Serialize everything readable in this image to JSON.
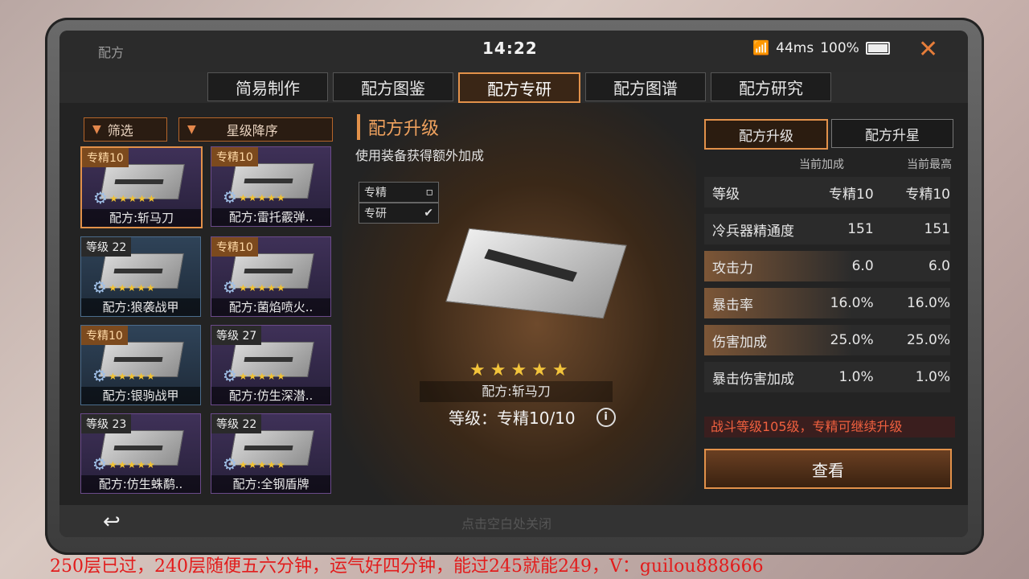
{
  "window": {
    "title": "配方",
    "time": "14:22",
    "ping": "44ms",
    "battery": "100%"
  },
  "tabs": [
    {
      "label": "简易制作"
    },
    {
      "label": "配方图鉴"
    },
    {
      "label": "配方专研",
      "active": true
    },
    {
      "label": "配方图谱"
    },
    {
      "label": "配方研究"
    }
  ],
  "filters": {
    "filter_label": "筛选",
    "sort_label": "星级降序"
  },
  "cards": [
    {
      "badge": "专精10",
      "name": "配方:斩马刀",
      "stars": "★★★★★"
    },
    {
      "badge": "专精10",
      "name": "配方:雷托霰弹..",
      "stars": "★★★★★"
    },
    {
      "badge": "等级 22",
      "name": "配方:狼袭战甲",
      "stars": "★★★★★"
    },
    {
      "badge": "专精10",
      "name": "配方:菌焰喷火..",
      "stars": "★★★★★"
    },
    {
      "badge": "专精10",
      "name": "配方:银驹战甲",
      "stars": "★★★★★"
    },
    {
      "badge": "等级 27",
      "name": "配方:仿生深潜..",
      "stars": "★★★★★"
    },
    {
      "badge": "等级 23",
      "name": "配方:仿生蛛鹬..",
      "stars": "★★★★★"
    },
    {
      "badge": "等级 22",
      "name": "配方:全钢盾牌",
      "stars": "★★★★★"
    }
  ],
  "center": {
    "title": "配方升级",
    "subtitle": "使用装备获得额外加成",
    "check1": "专精",
    "check2": "专研",
    "check2_mark": "✔",
    "stars": "★★★★★",
    "item_name": "配方:斩马刀",
    "level": "等级：专精10/10"
  },
  "right": {
    "tab_upgrade": "配方升级",
    "tab_star": "配方升星",
    "col_current": "当前加成",
    "col_max": "当前最高",
    "stats": [
      {
        "label": "等级",
        "current": "专精10",
        "max": "专精10"
      },
      {
        "label": "冷兵器精通度",
        "current": "151",
        "max": "151"
      },
      {
        "label": "攻击力",
        "current": "6.0",
        "max": "6.0"
      },
      {
        "label": "暴击率",
        "current": "16.0%",
        "max": "16.0%"
      },
      {
        "label": "伤害加成",
        "current": "25.0%",
        "max": "25.0%"
      },
      {
        "label": "暴击伤害加成",
        "current": "1.0%",
        "max": "1.0%"
      }
    ],
    "notice": "战斗等级105级，专精可继续升级",
    "view_button": "查看"
  },
  "bottom": {
    "tap_close": "点击空白处关闭"
  },
  "overlay_text": "250层已过，240层随便五六分钟，运气好四分钟，能过245就能249，V：guilou888666",
  "colors": {
    "accent": "#e2914a",
    "notice": "#f0603f",
    "overlay": "#e21c1c"
  }
}
